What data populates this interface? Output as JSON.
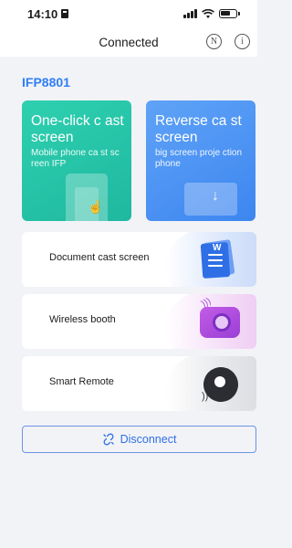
{
  "status_bar": {
    "time": "14:10"
  },
  "nav": {
    "title": "Connected",
    "nfc_icon_glyph": "N",
    "info_icon_glyph": "i"
  },
  "device": {
    "name": "IFP8801"
  },
  "cards": {
    "cast": {
      "title": "One-click c ast screen",
      "subtitle": "Mobile phone ca st screen IFP",
      "color": "#2ed0b0"
    },
    "reverse": {
      "title": "Reverse ca st screen",
      "subtitle": "big screen proje ction phone",
      "color": "#4a92f4"
    }
  },
  "list": [
    {
      "label": "Document cast screen",
      "icon": "document-icon"
    },
    {
      "label": "Wireless booth",
      "icon": "camera-icon"
    },
    {
      "label": "Smart Remote",
      "icon": "remote-icon"
    }
  ],
  "disconnect": {
    "label": "Disconnect",
    "icon": "broken-link-icon"
  },
  "colors": {
    "accent": "#2f6fe6",
    "background": "#f2f3f7"
  }
}
